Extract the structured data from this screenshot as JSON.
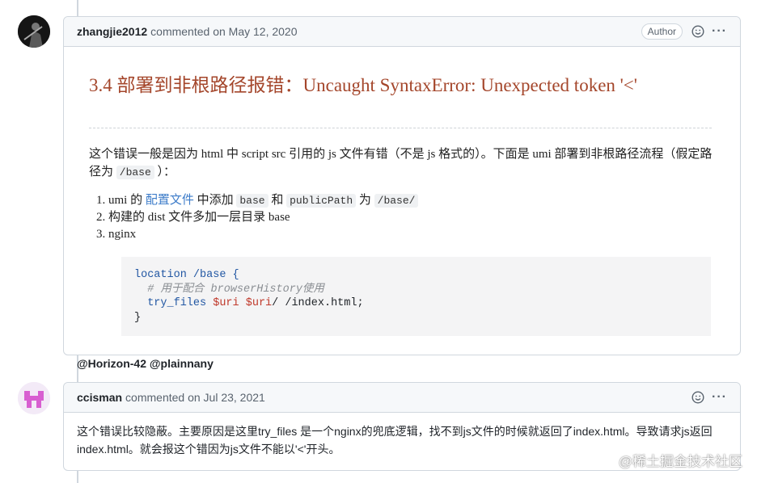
{
  "comment1": {
    "author": "zhangjie2012",
    "meta": "commented on May 12, 2020",
    "badge": "Author",
    "heading": "3.4 部署到非根路径报错：Uncaught SyntaxError: Unexpected token '<'",
    "para_a": "这个错误一般是因为 html 中 script src 引用的 js 文件有错（不是 js 格式的）。下面是 umi 部署到非根路径流程（假定路径为 ",
    "para_code": "/base",
    "para_b": " ）：",
    "steps": [
      {
        "a": "umi 的 ",
        "link": "配置文件",
        "b": " 中添加 ",
        "code1": "base",
        "c": " 和 ",
        "code2": "publicPath",
        "d": " 为 ",
        "code3": "/base/"
      },
      {
        "text": "构建的 dist 文件多加一层目录 base"
      },
      {
        "text": "nginx"
      }
    ],
    "code": {
      "l1_kw": "location",
      "l1_rest": " /base {",
      "l2": "  # 用于配合 browserHistory使用",
      "l3_kw": "  try_files",
      "l3_v1": " $uri",
      "l3_v2": " $uri",
      "l3_rest": "/ /index.html;",
      "l4": "}"
    },
    "mentions": "@Horizon-42 @plainnany"
  },
  "comment2": {
    "author": "ccisman",
    "meta": "commented on Jul 23, 2021",
    "text": "这个错误比较隐蔽。主要原因是这里try_files 是一个nginx的兜底逻辑，找不到js文件的时候就返回了index.html。导致请求js返回index.html。就会报这个错因为js文件不能以'<'开头。"
  },
  "watermark": "@稀土掘金技术社区",
  "icons": {
    "emoji": "smiley-icon",
    "more": "kebab-icon"
  },
  "colors": {
    "heading": "#a4462b",
    "link": "#3d7cc9",
    "avatar2": "#d85fd1"
  }
}
